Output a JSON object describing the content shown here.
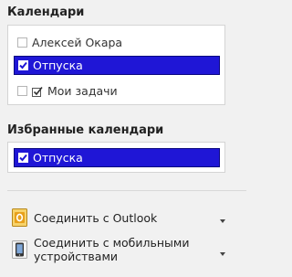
{
  "calendars": {
    "title": "Календари",
    "items": [
      {
        "label": "Алексей Окара",
        "checked": false,
        "selected": false
      },
      {
        "label": "Отпуска",
        "checked": true,
        "selected": true
      },
      {
        "label": "Мои задачи",
        "checked": false,
        "selected": false,
        "icon": "task-check-icon"
      }
    ]
  },
  "favorites": {
    "title": "Избранные календари",
    "items": [
      {
        "label": "Отпуска",
        "checked": true,
        "selected": true
      }
    ]
  },
  "links": [
    {
      "label": "Соединить с Outlook",
      "icon": "outlook-icon"
    },
    {
      "label": "Соединить с мобильными устройствами",
      "line1": "Соединить с мобильными",
      "line2": "устройствами",
      "icon": "mobile-phone-icon"
    }
  ],
  "colors": {
    "selected_bg": "#1f16d6",
    "page_bg": "#f1f1f1",
    "outlook_orange": "#e8a01b"
  }
}
